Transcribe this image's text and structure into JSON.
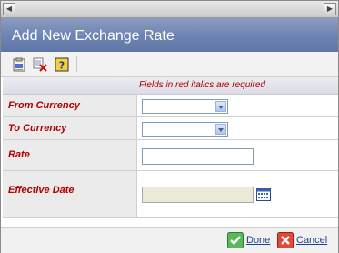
{
  "dialog": {
    "title": "Add New Exchange Rate"
  },
  "navigation": {
    "back_icon": "chevron-left-icon",
    "forward_icon": "chevron-right-icon"
  },
  "toolbar": {
    "icons": [
      "clipboard-icon",
      "delete-icon",
      "help-icon"
    ]
  },
  "form": {
    "required_hint": "Fields in red italics are required",
    "fields": [
      {
        "label": "From Currency",
        "type": "select",
        "value": ""
      },
      {
        "label": "To Currency",
        "type": "select",
        "value": ""
      },
      {
        "label": "Rate",
        "type": "text",
        "value": ""
      },
      {
        "label": "Effective Date",
        "type": "date",
        "value": ""
      }
    ]
  },
  "footer": {
    "done_label": "Done",
    "cancel_label": "Cancel"
  },
  "colors": {
    "title_bar": "#6f86b3",
    "required_label": "#b00000",
    "link": "#1f3f90"
  }
}
